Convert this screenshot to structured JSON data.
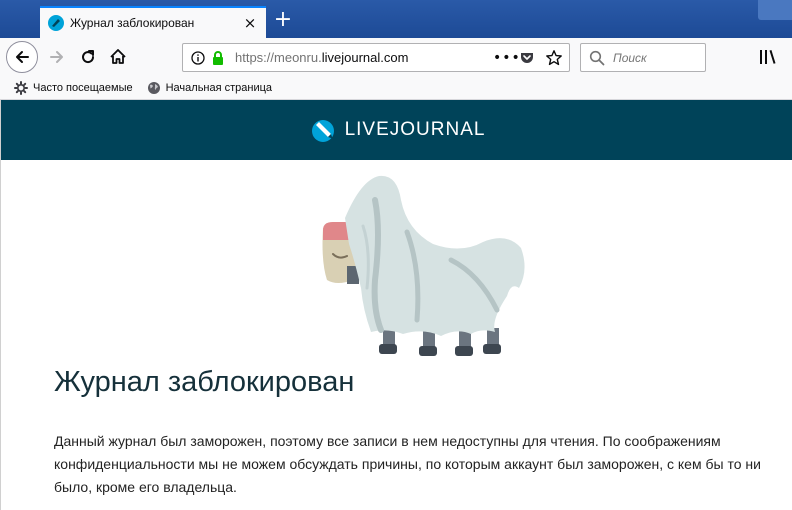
{
  "browser": {
    "tab_title": "Журнал заблокирован",
    "url_prefix": "https://meonru.",
    "url_domain": "livejournal.com",
    "search_placeholder": "Поиск",
    "page_actions_label": "•••",
    "new_tab_label": "+",
    "close_tab_label": "×"
  },
  "bookmarks": [
    {
      "label": "Часто посещаемые",
      "icon": "gear-icon"
    },
    {
      "label": "Начальная страница",
      "icon": "globe-icon"
    }
  ],
  "site": {
    "logo_text": "LIVEJOURNAL",
    "brand_color": "#004359",
    "accent_color": "#00a3d9"
  },
  "content": {
    "heading": "Журнал заблокирован",
    "description": "Данный журнал был заморожен, поэтому все записи в нем недоступны для чтения. По соображениям конфиденциальности мы не можем обсуждать причины, по которым аккаунт был заморожен, с кем бы то ни было, кроме его владельца."
  }
}
